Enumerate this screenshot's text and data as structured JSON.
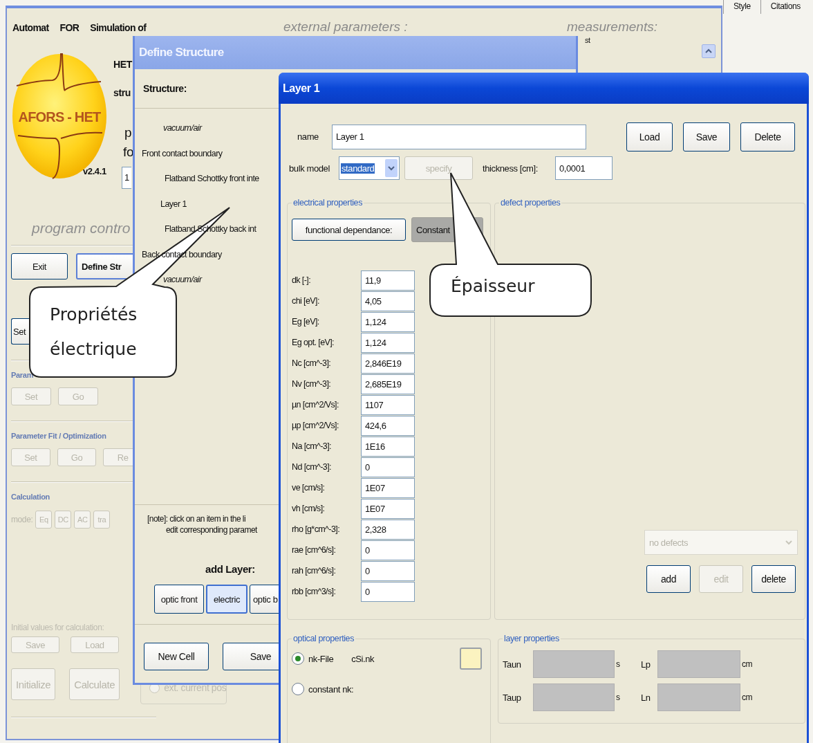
{
  "top_tabs": [
    {
      "label": "Style"
    },
    {
      "label": "Citations"
    }
  ],
  "main_window": {
    "heading": [
      "Automat",
      "FOR",
      "Simulation of"
    ],
    "external_parameters_label": "external parameters :",
    "measurements_label": "measurements:",
    "measurements_fragment": "st",
    "logo_text": "AFORS - HET",
    "version": "v2.4.1",
    "subtitle_fragments": [
      "HET",
      "stru"
    ],
    "description_fragments": [
      "p",
      "fo"
    ],
    "cut_field_value": "1",
    "program_control_label": "program contro",
    "control_buttons": [
      {
        "label": "Exit",
        "disabled": false,
        "default": false
      },
      {
        "label": "Define Str",
        "disabled": false,
        "default": true
      }
    ],
    "set_button": {
      "label": "Set",
      "disabled": false
    },
    "sections": [
      {
        "kind": "buttons",
        "title": "Param",
        "buttons": [
          {
            "label": "Set",
            "disabled": true
          },
          {
            "label": "Go",
            "disabled": true
          }
        ]
      },
      {
        "kind": "buttons",
        "title": "Parameter Fit / Optimization",
        "buttons": [
          {
            "label": "Set",
            "disabled": true
          },
          {
            "label": "Go",
            "disabled": true
          },
          {
            "label": "Re",
            "disabled": true
          }
        ]
      },
      {
        "kind": "mode",
        "title": "Calculation",
        "mode_label": "mode:",
        "buttons": [
          {
            "label": "Eq",
            "disabled": true
          },
          {
            "label": "DC",
            "disabled": true
          },
          {
            "label": "AC",
            "disabled": true
          },
          {
            "label": "tra",
            "disabled": true
          }
        ]
      }
    ],
    "initial_values_label": "Initial values for calculation:",
    "initial_values_buttons": [
      {
        "label": "Save",
        "disabled": true
      },
      {
        "label": "Load",
        "disabled": true
      }
    ],
    "run_buttons": [
      {
        "label": "Initialize",
        "disabled": true
      },
      {
        "label": "Calculate",
        "disabled": true
      }
    ],
    "ext_option": {
      "label": "ext. current pos",
      "selected": false,
      "disabled": true
    }
  },
  "define_structure": {
    "title": "Define Structure",
    "structure_label": "Structure:",
    "tree": [
      {
        "kind": "medium",
        "label": "vacuum/air"
      },
      {
        "kind": "boundary",
        "label": "Front contact boundary"
      },
      {
        "kind": "interface",
        "label": "Flatband Schottky front inte"
      },
      {
        "kind": "layer",
        "label": "Layer 1"
      },
      {
        "kind": "interface",
        "label": "Flatband Schottky back int"
      },
      {
        "kind": "boundary",
        "label": "Back contact boundary"
      },
      {
        "kind": "medium",
        "label": "vacuum/air"
      }
    ],
    "note_lines": [
      "[note]: click on an item in the li",
      "edit corresponding paramet"
    ],
    "add_layer_label": "add Layer:",
    "add_layer_buttons": [
      {
        "label": "optic front",
        "selected": false
      },
      {
        "label": "electric",
        "selected": true
      },
      {
        "label": "optic b",
        "selected": false
      }
    ],
    "buttons": [
      {
        "label": "New Cell"
      },
      {
        "label": "Save"
      }
    ]
  },
  "layer_window": {
    "title": "Layer 1",
    "name_label": "name",
    "name_value": "Layer 1",
    "file_buttons": [
      {
        "label": "Load"
      },
      {
        "label": "Save"
      },
      {
        "label": "Delete"
      }
    ],
    "bulk_model_label": "bulk model",
    "bulk_model_value": "standard",
    "bulk_model_highlighted": true,
    "specify_button": {
      "label": "specify",
      "disabled": true
    },
    "thickness_label": "thickness [cm]:",
    "thickness_value": "0,0001",
    "electrical": {
      "title": "electrical properties",
      "mode_buttons": [
        {
          "label": "functional dependance:",
          "selected": false
        },
        {
          "label": "Constant",
          "selected": true
        }
      ],
      "parameters": [
        {
          "label": "dk [-]:",
          "value": "11,9"
        },
        {
          "label": "chi [eV]:",
          "value": "4,05"
        },
        {
          "label": "Eg [eV]:",
          "value": "1,124"
        },
        {
          "label": "Eg opt. [eV]:",
          "value": "1,124"
        },
        {
          "label": "Nc [cm^-3]:",
          "value": "2,846E19"
        },
        {
          "label": "Nv [cm^-3]:",
          "value": "2,685E19"
        },
        {
          "label": "µn [cm^2/Vs]:",
          "value": "1107"
        },
        {
          "label": "µp [cm^2/Vs]:",
          "value": "424,6"
        },
        {
          "label": "Na [cm^-3]:",
          "value": "1E16"
        },
        {
          "label": "Nd [cm^-3]:",
          "value": "0"
        },
        {
          "label": "ve [cm/s]:",
          "value": "1E07"
        },
        {
          "label": "vh [cm/s]:",
          "value": "1E07"
        },
        {
          "label": "rho [g*cm^-3]:",
          "value": "2,328"
        },
        {
          "label": "rae [cm^6/s]:",
          "value": "0"
        },
        {
          "label": "rah [cm^6/s]:",
          "value": "0"
        },
        {
          "label": "rbb [cm^3/s]:",
          "value": "0"
        }
      ]
    },
    "defects": {
      "title": "defect properties",
      "select_value": "no defects",
      "select_disabled": true,
      "buttons": [
        {
          "label": "add",
          "disabled": false
        },
        {
          "label": "edit",
          "disabled": true
        },
        {
          "label": "delete",
          "disabled": false
        }
      ]
    },
    "optical": {
      "title": "optical properties",
      "options": [
        {
          "label": "nk-File",
          "selected": true,
          "file": "cSi.nk"
        },
        {
          "label": "constant nk:",
          "selected": false
        }
      ]
    },
    "layer_properties": {
      "title": "layer properties",
      "fields": [
        {
          "label": "Taun",
          "unit": "s",
          "disabled": true
        },
        {
          "label": "Lp",
          "unit": "cm",
          "disabled": true
        },
        {
          "label": "Taup",
          "unit": "s",
          "disabled": true
        },
        {
          "label": "Ln",
          "unit": "cm",
          "disabled": true
        }
      ]
    }
  },
  "callouts": [
    {
      "text": "Propriétés électrique"
    },
    {
      "text": "Épaisseur"
    }
  ]
}
